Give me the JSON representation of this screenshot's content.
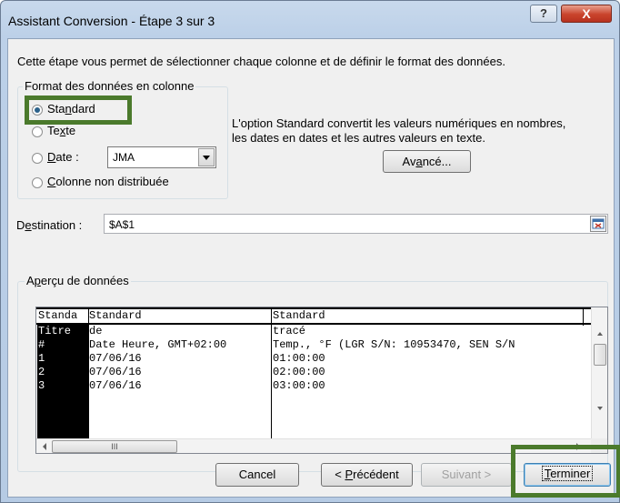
{
  "window": {
    "title": "Assistant Conversion - Étape 3 sur 3",
    "help": "?",
    "close": "X"
  },
  "intro": "Cette étape vous permet de sélectionner chaque colonne et de définir le format des données.",
  "format_group": {
    "legend": "Format des données en colonne",
    "options": [
      {
        "pre": "Sta",
        "u": "n",
        "post": "dard",
        "checked": true
      },
      {
        "pre": "Te",
        "u": "x",
        "post": "te",
        "checked": false
      },
      {
        "pre": "",
        "u": "D",
        "post": "ate :",
        "checked": false
      },
      {
        "pre": "",
        "u": "C",
        "post": "olonne non distribuée",
        "checked": false
      }
    ],
    "date_format": "JMA"
  },
  "description": [
    "L'option Standard convertit les valeurs numériques en nombres,",
    "les dates en dates et les autres valeurs en texte."
  ],
  "advanced_button": {
    "pre": "Av",
    "u": "a",
    "post": "ncé..."
  },
  "destination": {
    "pre": "D",
    "u": "e",
    "post": "stination :",
    "value": "$A$1"
  },
  "preview": {
    "legend_pre": "A",
    "legend_u": "p",
    "legend_post": "erçu de données",
    "headers": [
      "Standa",
      "Standard",
      "Standard"
    ],
    "rows": [
      [
        "Titre",
        "de",
        "tracé"
      ],
      [
        "#",
        "Date Heure, GMT+02:00",
        "Temp., °F (LGR S/N: 10953470, SEN S/N"
      ],
      [
        "1",
        "07/06/16",
        "01:00:00"
      ],
      [
        "2",
        "07/06/16",
        "02:00:00"
      ],
      [
        "3",
        "07/06/16",
        "03:00:00"
      ]
    ],
    "hscroll_grip": "III"
  },
  "buttons": {
    "cancel": "Cancel",
    "previous": {
      "pre": "< ",
      "u": "P",
      "post": "récédent"
    },
    "next": "Suivant >",
    "finish": {
      "pre": "",
      "u": "T",
      "post": "erminer"
    }
  },
  "colors": {
    "highlight": "#4b7a2c",
    "selection": "#000000"
  }
}
